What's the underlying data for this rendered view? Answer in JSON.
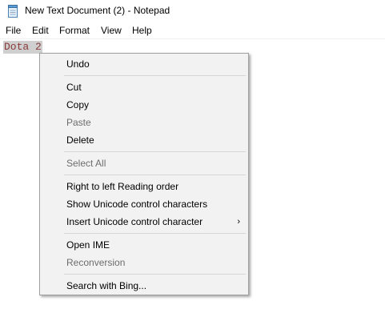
{
  "window": {
    "title": "New Text Document (2) - Notepad",
    "app_icon": "notepad-icon"
  },
  "menubar": {
    "items": [
      {
        "label": "File"
      },
      {
        "label": "Edit"
      },
      {
        "label": "Format"
      },
      {
        "label": "View"
      },
      {
        "label": "Help"
      }
    ]
  },
  "editor": {
    "selected_text": "Dota 2"
  },
  "context_menu": {
    "undo": "Undo",
    "cut": "Cut",
    "copy": "Copy",
    "paste": "Paste",
    "delete": "Delete",
    "select_all": "Select All",
    "rtl_reading_order": "Right to left Reading order",
    "show_unicode": "Show Unicode control characters",
    "insert_unicode": "Insert Unicode control character",
    "submenu_arrow": "›",
    "open_ime": "Open IME",
    "reconversion": "Reconversion",
    "search_bing": "Search with Bing..."
  },
  "colors": {
    "menu_background": "#f2f2f2",
    "disabled_text": "#6d6d6d",
    "selection_highlight": "#cfcfcf"
  }
}
